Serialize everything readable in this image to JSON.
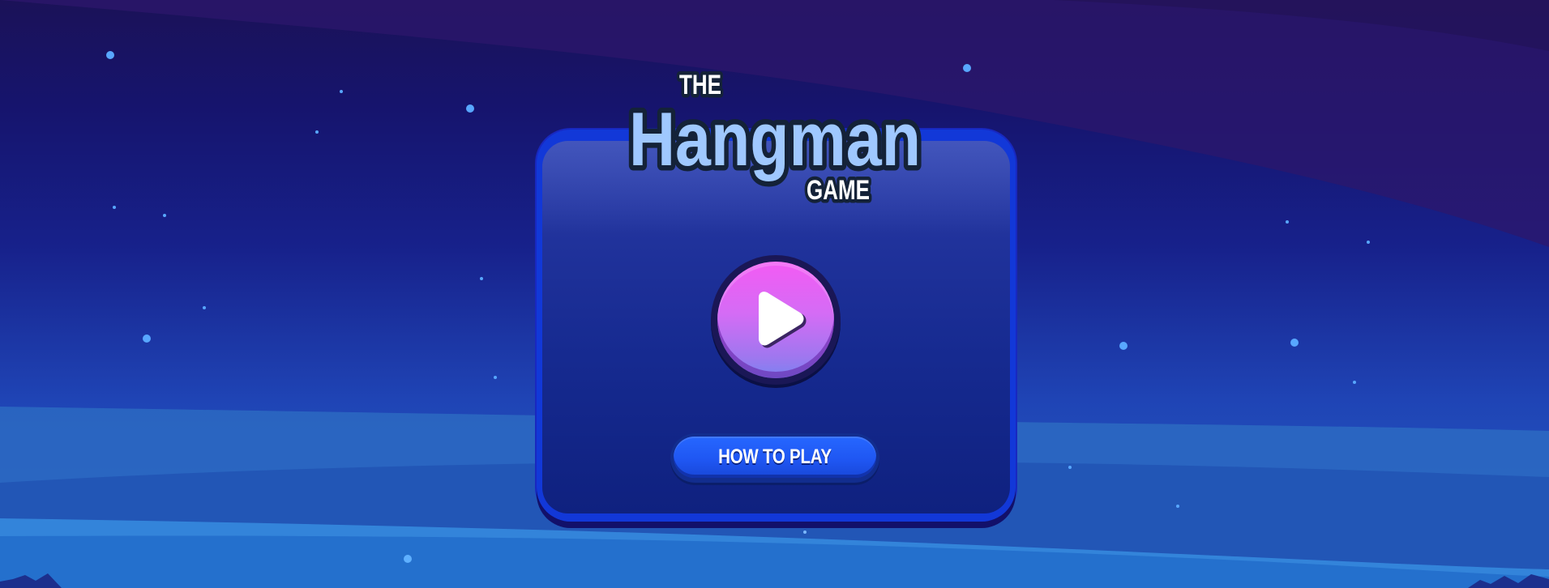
{
  "game": {
    "title_small": "THE",
    "title_main": "Hangman",
    "title_sub": "GAME",
    "play_icon": "play-icon",
    "how_to_play_label": "HOW TO PLAY"
  },
  "colors": {
    "background_top": "#1b1258",
    "background_bottom": "#2463c7",
    "card_border": "#1238d8",
    "card_fill": "#162a90",
    "play_button_top": "#f35bf4",
    "play_button_bottom": "#7a83f0",
    "how_button": "#1f56f2",
    "logo_text": "#9fc8ff",
    "logo_outline": "#142238"
  }
}
